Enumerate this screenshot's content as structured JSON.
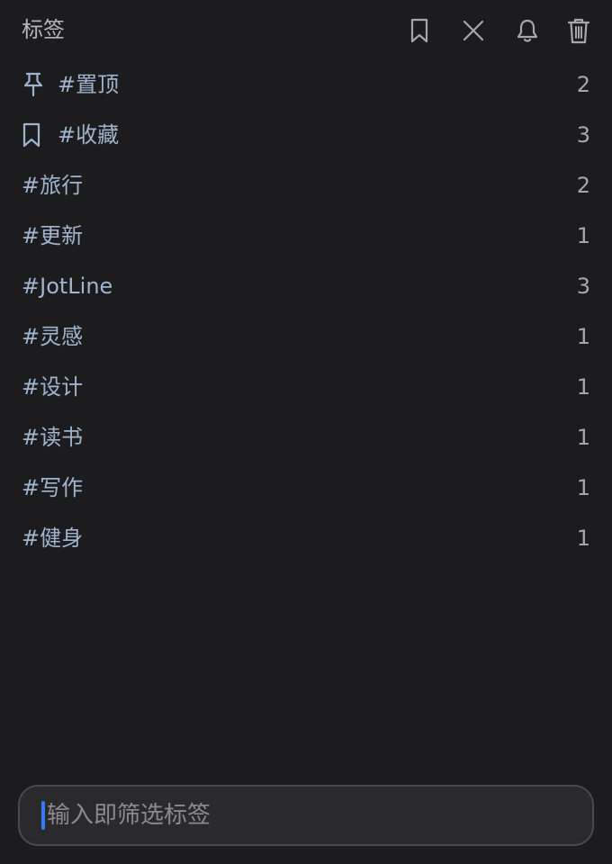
{
  "header": {
    "title": "标签",
    "actions": [
      {
        "name": "bookmark-icon"
      },
      {
        "name": "close-icon"
      },
      {
        "name": "bell-icon"
      },
      {
        "name": "trash-icon"
      }
    ]
  },
  "tags": [
    {
      "icon": "pin-icon",
      "name": "#置顶",
      "count": "2"
    },
    {
      "icon": "bookmark-icon",
      "name": "#收藏",
      "count": "3"
    },
    {
      "icon": "",
      "name": "#旅行",
      "count": "2"
    },
    {
      "icon": "",
      "name": "#更新",
      "count": "1"
    },
    {
      "icon": "",
      "name": "#JotLine",
      "count": "3"
    },
    {
      "icon": "",
      "name": "#灵感",
      "count": "1"
    },
    {
      "icon": "",
      "name": "#设计",
      "count": "1"
    },
    {
      "icon": "",
      "name": "#读书",
      "count": "1"
    },
    {
      "icon": "",
      "name": "#写作",
      "count": "1"
    },
    {
      "icon": "",
      "name": "#健身",
      "count": "1"
    }
  ],
  "search": {
    "value": "",
    "placeholder": "输入即筛选标签"
  },
  "colors": {
    "background": "#1c1c1e",
    "tag_text": "#9fb4ce",
    "count_text": "#a6a6ab",
    "caret": "#2f7cf6"
  }
}
